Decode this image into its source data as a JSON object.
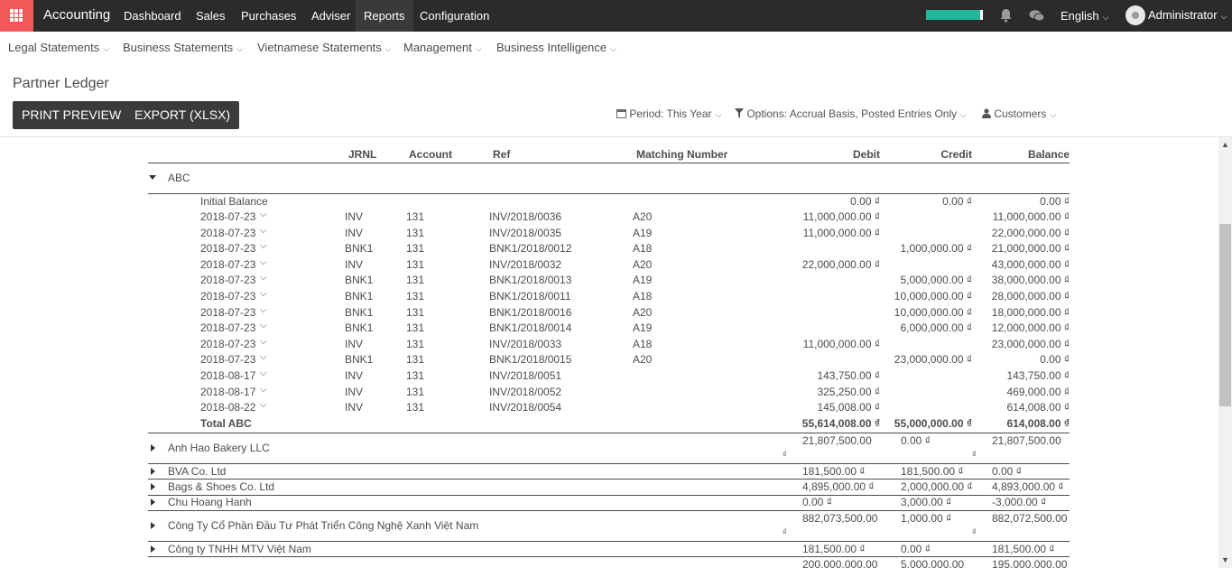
{
  "navbar": {
    "brand": "Accounting",
    "menus": [
      "Dashboard",
      "Sales",
      "Purchases",
      "Adviser",
      "Reports",
      "Configuration"
    ],
    "active_menu": "Reports",
    "progress_fraction": 0.95,
    "language": "English",
    "user": "Administrator",
    "icons": [
      "apps-grid-icon",
      "bell-icon",
      "chat-icon",
      "avatar"
    ]
  },
  "submenu": [
    "Legal Statements",
    "Business Statements",
    "Vietnamese Statements",
    "Management",
    "Business Intelligence"
  ],
  "control_panel": {
    "title": "Partner Ledger",
    "print_label": "PRINT PREVIEW",
    "export_label": "EXPORT (XLSX)",
    "period_label": "Period: This Year",
    "options_label": "Options: Accrual Basis, Posted Entries Only",
    "partner_label": "Customers"
  },
  "table": {
    "columns": [
      "JRNL",
      "Account",
      "Ref",
      "Matching Number",
      "Debit",
      "Credit",
      "Balance"
    ],
    "expanded_partner": "ABC",
    "initial_balance": {
      "label": "Initial Balance",
      "debit": "0.00 ₫",
      "credit": "0.00 ₫",
      "balance": "0.00 ₫"
    },
    "lines": [
      {
        "date": "2018-07-23",
        "jrnl": "INV",
        "account": "131",
        "ref": "INV/2018/0036",
        "match": "A20",
        "debit": "11,000,000.00 ₫",
        "credit": "",
        "balance": "11,000,000.00 ₫"
      },
      {
        "date": "2018-07-23",
        "jrnl": "INV",
        "account": "131",
        "ref": "INV/2018/0035",
        "match": "A19",
        "debit": "11,000,000.00 ₫",
        "credit": "",
        "balance": "22,000,000.00 ₫"
      },
      {
        "date": "2018-07-23",
        "jrnl": "BNK1",
        "account": "131",
        "ref": "BNK1/2018/0012",
        "match": "A18",
        "debit": "",
        "credit": "1,000,000.00 ₫",
        "balance": "21,000,000.00 ₫"
      },
      {
        "date": "2018-07-23",
        "jrnl": "INV",
        "account": "131",
        "ref": "INV/2018/0032",
        "match": "A20",
        "debit": "22,000,000.00 ₫",
        "credit": "",
        "balance": "43,000,000.00 ₫"
      },
      {
        "date": "2018-07-23",
        "jrnl": "BNK1",
        "account": "131",
        "ref": "BNK1/2018/0013",
        "match": "A19",
        "debit": "",
        "credit": "5,000,000.00 ₫",
        "balance": "38,000,000.00 ₫"
      },
      {
        "date": "2018-07-23",
        "jrnl": "BNK1",
        "account": "131",
        "ref": "BNK1/2018/0011",
        "match": "A18",
        "debit": "",
        "credit": "10,000,000.00 ₫",
        "balance": "28,000,000.00 ₫"
      },
      {
        "date": "2018-07-23",
        "jrnl": "BNK1",
        "account": "131",
        "ref": "BNK1/2018/0016",
        "match": "A20",
        "debit": "",
        "credit": "10,000,000.00 ₫",
        "balance": "18,000,000.00 ₫"
      },
      {
        "date": "2018-07-23",
        "jrnl": "BNK1",
        "account": "131",
        "ref": "BNK1/2018/0014",
        "match": "A19",
        "debit": "",
        "credit": "6,000,000.00 ₫",
        "balance": "12,000,000.00 ₫"
      },
      {
        "date": "2018-07-23",
        "jrnl": "INV",
        "account": "131",
        "ref": "INV/2018/0033",
        "match": "A18",
        "debit": "11,000,000.00 ₫",
        "credit": "",
        "balance": "23,000,000.00 ₫"
      },
      {
        "date": "2018-07-23",
        "jrnl": "BNK1",
        "account": "131",
        "ref": "BNK1/2018/0015",
        "match": "A20",
        "debit": "",
        "credit": "23,000,000.00 ₫",
        "balance": "0.00 ₫"
      },
      {
        "date": "2018-08-17",
        "jrnl": "INV",
        "account": "131",
        "ref": "INV/2018/0051",
        "match": "",
        "debit": "143,750.00 ₫",
        "credit": "",
        "balance": "143,750.00 ₫"
      },
      {
        "date": "2018-08-17",
        "jrnl": "INV",
        "account": "131",
        "ref": "INV/2018/0052",
        "match": "",
        "debit": "325,250.00 ₫",
        "credit": "",
        "balance": "469,000.00 ₫"
      },
      {
        "date": "2018-08-22",
        "jrnl": "INV",
        "account": "131",
        "ref": "INV/2018/0054",
        "match": "",
        "debit": "145,008.00 ₫",
        "credit": "",
        "balance": "614,008.00 ₫"
      }
    ],
    "total": {
      "label": "Total ABC",
      "debit": "55,614,008.00 ₫",
      "credit": "55,000,000.00 ₫",
      "balance": "614,008.00 ₫"
    },
    "partners": [
      {
        "name": "Anh Hao Bakery LLC",
        "debit": "21,807,500.00",
        "credit": "0.00 ₫",
        "balance": "21,807,500.00",
        "wrap": true
      },
      {
        "name": "BVA Co. Ltd",
        "debit": "181,500.00 ₫",
        "credit": "181,500.00 ₫",
        "balance": "0.00 ₫",
        "wrap": false
      },
      {
        "name": "Bags & Shoes Co. Ltd",
        "debit": "4,895,000.00 ₫",
        "credit": "2,000,000.00 ₫",
        "balance": "4,893,000.00 ₫",
        "wrap": false
      },
      {
        "name": "Chu Hoang Hanh",
        "debit": "0.00 ₫",
        "credit": "3,000.00 ₫",
        "balance": "-3,000.00 ₫",
        "wrap": false
      },
      {
        "name": "Công Ty Cổ Phần Đầu Tư Phát Triển Công Nghệ Xanh Việt Nam",
        "debit": "882,073,500.00",
        "credit": "1,000.00 ₫",
        "balance": "882,072,500.00",
        "wrap": true
      },
      {
        "name": "Công ty TNHH MTV Việt Nam",
        "debit": "181,500.00 ₫",
        "credit": "0.00 ₫",
        "balance": "181,500.00 ₫",
        "wrap": false
      },
      {
        "name": "",
        "debit": "200,000,000.00",
        "credit": "5,000,000.00",
        "balance": "195,000,000.00",
        "wrap": true
      }
    ],
    "currency_symbol": "₫"
  }
}
